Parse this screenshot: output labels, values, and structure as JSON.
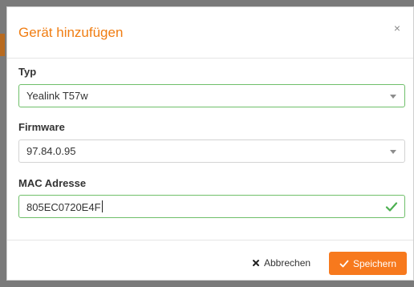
{
  "dialog": {
    "title": "Gerät hinzufügen",
    "close_symbol": "×"
  },
  "fields": {
    "typ": {
      "label": "Typ",
      "value": "Yealink T57w",
      "state": "valid"
    },
    "firmware": {
      "label": "Firmware",
      "value": "97.84.0.95"
    },
    "mac": {
      "label": "MAC Adresse",
      "value": "805EC0720E4F",
      "state": "valid"
    }
  },
  "footer": {
    "cancel_label": "Abbrechen",
    "save_label": "Speichern"
  },
  "icons": {
    "close": "close-icon",
    "dropdown": "chevron-down-icon",
    "valid": "check-icon",
    "cancel": "x-icon",
    "save": "check-icon"
  },
  "colors": {
    "accent": "#f07d12",
    "save_button": "#f7791d",
    "valid": "#4caf50"
  }
}
